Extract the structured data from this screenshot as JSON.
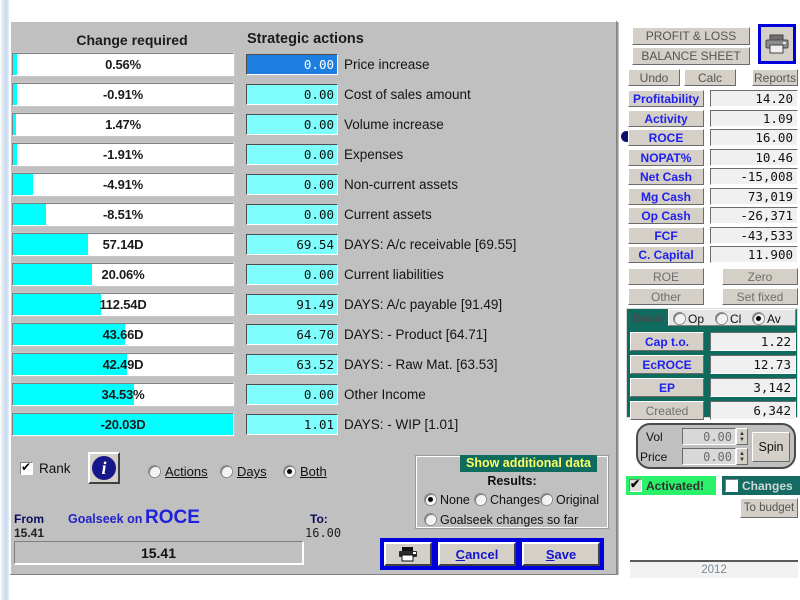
{
  "columns": {
    "change_required": "Change required",
    "strategic_actions": "Strategic actions"
  },
  "rows": [
    {
      "change": "0.56%",
      "bar_pct": 2,
      "action": "0.00",
      "label": "Price increase",
      "selected": true
    },
    {
      "change": "-0.91%",
      "bar_pct": 2,
      "action": "0.00",
      "label": "Cost of sales amount",
      "selected": false
    },
    {
      "change": "1.47%",
      "bar_pct": 1.5,
      "action": "0.00",
      "label": "Volume increase",
      "selected": false
    },
    {
      "change": "-1.91%",
      "bar_pct": 2,
      "action": "0.00",
      "label": "Expenses",
      "selected": false
    },
    {
      "change": "-4.91%",
      "bar_pct": 9,
      "action": "0.00",
      "label": "Non-current assets",
      "selected": false
    },
    {
      "change": "-8.51%",
      "bar_pct": 15,
      "action": "0.00",
      "label": "Current assets",
      "selected": false
    },
    {
      "change": "57.14D",
      "bar_pct": 34,
      "action": "69.54",
      "label": "DAYS: A/c receivable [69.55]",
      "selected": false
    },
    {
      "change": "20.06%",
      "bar_pct": 36,
      "action": "0.00",
      "label": "Current liabilities",
      "selected": false
    },
    {
      "change": "112.54D",
      "bar_pct": 40,
      "action": "91.49",
      "label": "DAYS: A/c payable [91.49]",
      "selected": false
    },
    {
      "change": "43.66D",
      "bar_pct": 51,
      "action": "64.70",
      "label": "DAYS: - Product [64.71]",
      "selected": false
    },
    {
      "change": "42.49D",
      "bar_pct": 52,
      "action": "63.52",
      "label": "DAYS: - Raw Mat. [63.53]",
      "selected": false
    },
    {
      "change": "34.53%",
      "bar_pct": 55,
      "action": "0.00",
      "label": "Other Income",
      "selected": false
    },
    {
      "change": "-20.03D",
      "bar_pct": 100,
      "action": "1.01",
      "label": "DAYS: - WIP [1.01]",
      "selected": false
    }
  ],
  "bottom_controls": {
    "rank_label": "Rank",
    "rank_checked": true,
    "info_glyph": "i",
    "view_options": [
      {
        "label": "Actions",
        "selected": false
      },
      {
        "label": "Days",
        "selected": false
      },
      {
        "label": "Both",
        "selected": true
      }
    ]
  },
  "additional_data": {
    "title": "Show additional data",
    "results_label": "Results:",
    "options": [
      {
        "label": "None",
        "selected": true
      },
      {
        "label": "Changes",
        "selected": false
      },
      {
        "label": "Original",
        "selected": false
      },
      {
        "label": "Goalseek changes so far",
        "selected": false
      }
    ]
  },
  "goalseek": {
    "from_label": "From",
    "from_value": "15.41",
    "prefix": "Goalseek on",
    "target": "ROCE",
    "to_label": "To:",
    "to_value": "16.00",
    "readout": "15.41"
  },
  "dialog_buttons": {
    "print": "print-icon",
    "cancel": "Cancel",
    "save": "Save"
  },
  "sidebar": {
    "top_buttons": [
      {
        "label": "PROFIT & LOSS"
      },
      {
        "label": "BALANCE SHEET"
      }
    ],
    "action_buttons": [
      {
        "label": "Undo"
      },
      {
        "label": "Calc"
      },
      {
        "label": "Reports"
      }
    ],
    "print_icon": "printer-icon",
    "metrics": [
      {
        "name": "Profitability",
        "value": "14.20",
        "active": false
      },
      {
        "name": "Activity",
        "value": "1.09",
        "active": false
      },
      {
        "name": "ROCE",
        "value": "16.00",
        "active": true
      },
      {
        "name": "NOPAT%",
        "value": "10.46",
        "active": false
      },
      {
        "name": "Net Cash",
        "value": "-15,008",
        "active": false
      },
      {
        "name": "Mg Cash",
        "value": "73,019",
        "active": false
      },
      {
        "name": "Op Cash",
        "value": "-26,371",
        "active": false
      },
      {
        "name": "FCF",
        "value": "-43,533",
        "active": false
      },
      {
        "name": "C. Capital",
        "value": "11.900",
        "active": false
      }
    ],
    "extra_buttons": [
      {
        "label": "ROE",
        "partner": "Zero"
      },
      {
        "label": "Other",
        "partner": "Set fixed"
      }
    ],
    "basis": {
      "label": "Basis",
      "options": [
        {
          "label": "Op",
          "selected": false
        },
        {
          "label": "Cl",
          "selected": false
        },
        {
          "label": "Av",
          "selected": true
        }
      ]
    },
    "teal_metrics": [
      {
        "name": "Cap t.o.",
        "value": "1.22",
        "dim": false
      },
      {
        "name": "EcROCE",
        "value": "12.73",
        "dim": false
      },
      {
        "name": "EP",
        "value": "3,142",
        "dim": false
      },
      {
        "name": "Created",
        "value": "6,342",
        "dim": true
      }
    ],
    "spin": {
      "vol_label": "Vol",
      "vol_value": "0.00",
      "price_label": "Price",
      "price_value": "0.00",
      "spin_button": "Spin"
    },
    "activated": {
      "label": "Activated!",
      "checked": true
    },
    "changes": {
      "label": "Changes",
      "checked": false
    },
    "to_budget": "To budget",
    "year": "2012"
  },
  "colors": {
    "bar_cyan": "#00ffff",
    "input_cyan": "#7ffcfc",
    "selection_blue": "#1f7fe0",
    "teal": "#0e6b5e",
    "green": "#2bf06a",
    "accent_blue": "#2020ee",
    "dialog_border": "#0000dd"
  }
}
